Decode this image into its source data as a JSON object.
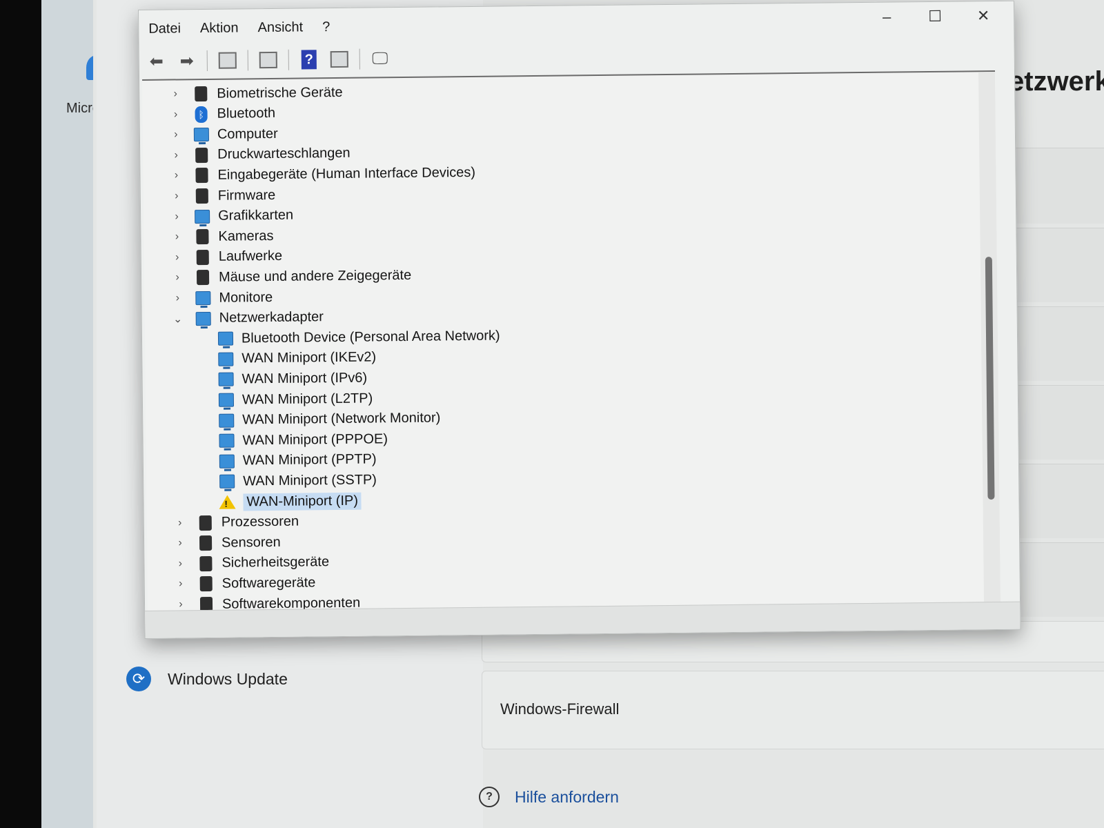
{
  "background": {
    "desktop_label": "Micro",
    "settings_heading": "etzwerk",
    "windows_update_label": "Windows Update",
    "firewall_label": "Windows-Firewall",
    "help_label": "Hilfe anfordern"
  },
  "window": {
    "controls": {
      "minimize": "–",
      "maximize": "☐",
      "close": "✕"
    },
    "menu": [
      "Datei",
      "Aktion",
      "Ansicht",
      "?"
    ]
  },
  "toolbar": {
    "back_icon": "arrow-left-icon",
    "forward_icon": "arrow-right-icon",
    "help_glyph": "?"
  },
  "tree": [
    {
      "label": "Biometrische Geräte",
      "icon": "fingerprint-icon",
      "expand": "›",
      "level": 0
    },
    {
      "label": "Bluetooth",
      "icon": "bluetooth-icon",
      "expand": "›",
      "level": 0
    },
    {
      "label": "Computer",
      "icon": "computer-icon",
      "expand": "›",
      "level": 0
    },
    {
      "label": "Druckwarteschlangen",
      "icon": "printer-icon",
      "expand": "›",
      "level": 0
    },
    {
      "label": "Eingabegeräte (Human Interface Devices)",
      "icon": "hid-icon",
      "expand": "›",
      "level": 0
    },
    {
      "label": "Firmware",
      "icon": "firmware-icon",
      "expand": "›",
      "level": 0
    },
    {
      "label": "Grafikkarten",
      "icon": "display-adapter-icon",
      "expand": "›",
      "level": 0
    },
    {
      "label": "Kameras",
      "icon": "camera-icon",
      "expand": "›",
      "level": 0
    },
    {
      "label": "Laufwerke",
      "icon": "disk-drive-icon",
      "expand": "›",
      "level": 0
    },
    {
      "label": "Mäuse und andere Zeigegeräte",
      "icon": "mouse-icon",
      "expand": "›",
      "level": 0
    },
    {
      "label": "Monitore",
      "icon": "monitor-icon",
      "expand": "›",
      "level": 0
    },
    {
      "label": "Netzwerkadapter",
      "icon": "network-adapter-icon",
      "expand": "⌄",
      "level": 0
    },
    {
      "label": "Bluetooth Device (Personal Area Network)",
      "icon": "network-adapter-icon",
      "expand": "",
      "level": 1
    },
    {
      "label": "WAN Miniport (IKEv2)",
      "icon": "network-adapter-icon",
      "expand": "",
      "level": 1
    },
    {
      "label": "WAN Miniport (IPv6)",
      "icon": "network-adapter-icon",
      "expand": "",
      "level": 1
    },
    {
      "label": "WAN Miniport (L2TP)",
      "icon": "network-adapter-icon",
      "expand": "",
      "level": 1
    },
    {
      "label": "WAN Miniport (Network Monitor)",
      "icon": "network-adapter-icon",
      "expand": "",
      "level": 1
    },
    {
      "label": "WAN Miniport (PPPOE)",
      "icon": "network-adapter-icon",
      "expand": "",
      "level": 1
    },
    {
      "label": "WAN Miniport (PPTP)",
      "icon": "network-adapter-icon",
      "expand": "",
      "level": 1
    },
    {
      "label": "WAN Miniport (SSTP)",
      "icon": "network-adapter-icon",
      "expand": "",
      "level": 1
    },
    {
      "label": "WAN-Miniport (IP)",
      "icon": "warning-icon",
      "expand": "",
      "level": 1,
      "selected": true
    },
    {
      "label": "Prozessoren",
      "icon": "processor-icon",
      "expand": "›",
      "level": 0
    },
    {
      "label": "Sensoren",
      "icon": "sensor-icon",
      "expand": "›",
      "level": 0
    },
    {
      "label": "Sicherheitsgeräte",
      "icon": "security-device-icon",
      "expand": "›",
      "level": 0
    },
    {
      "label": "Softwaregeräte",
      "icon": "software-device-icon",
      "expand": "›",
      "level": 0
    },
    {
      "label": "Softwarekomponenten",
      "icon": "software-component-icon",
      "expand": "›",
      "level": 0
    }
  ]
}
